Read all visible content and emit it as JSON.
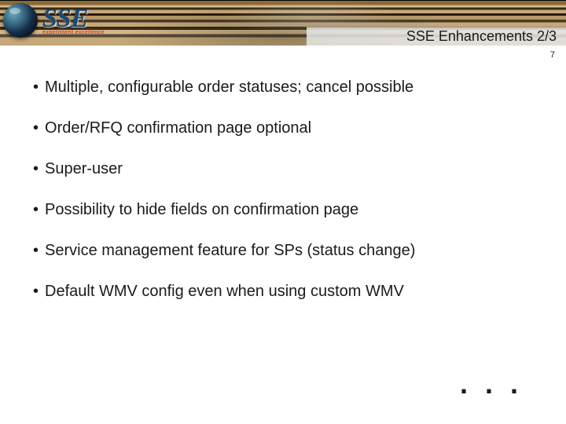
{
  "logo": {
    "main": "SSE",
    "tagline": "experiment excellence"
  },
  "slide": {
    "title": "SSE Enhancements 2/3",
    "page_number": "7",
    "ellipsis": ". . ."
  },
  "bullets": [
    "Multiple, configurable order statuses; cancel possible",
    "Order/RFQ confirmation page optional",
    "Super-user",
    "Possibility to hide fields on confirmation page",
    "Service management feature for SPs (status change)",
    "Default WMV config even when using custom WMV"
  ]
}
